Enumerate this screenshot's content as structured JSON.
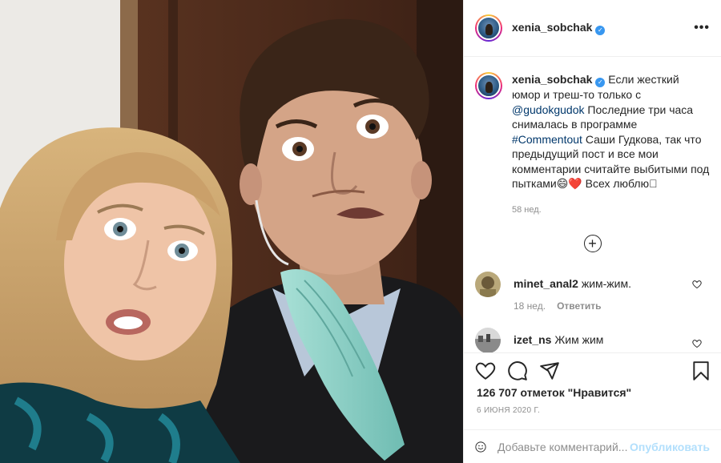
{
  "post": {
    "author": "xenia_sobchak",
    "photo_alt": "Ксения Собчак и Саша Гудков, селфи с удивлёнными лицами"
  },
  "header": {
    "username": "xenia_sobchak",
    "more_label": "•••"
  },
  "caption": {
    "author": "xenia_sobchak",
    "text_1": "Если жесткий юмор и треш-то только с ",
    "mention": "@gudokgudok",
    "text_2": " Последние три часа снималась в программе ",
    "hashtag": "#Commentout",
    "text_3": " Саши Гудкова, так что предыдущий пост и все мои комментарии считайте выбитыми под пытками😄❤️ Всех люблю🏻",
    "time": "58 нед."
  },
  "load_more": "+",
  "comments": [
    {
      "author": "minet_anal2",
      "text": "жим-жим.",
      "time": "18 нед.",
      "reply": "Ответить"
    },
    {
      "author": "izet_ns",
      "text": "Жим жим"
    }
  ],
  "likes": "126 707 отметок \"Нравится\"",
  "date": "6 ИЮНЯ 2020 Г.",
  "add_comment": {
    "placeholder": "Добавьте комментарий...",
    "publish": "Опубликовать"
  },
  "colors": {
    "link": "#00376b",
    "verified": "#3897f0",
    "publish_disabled": "#b2dffc",
    "muted": "#8e8e8e"
  },
  "icons": [
    "verified-icon",
    "more-icon",
    "plus-icon",
    "heart-icon",
    "comment-icon",
    "share-icon",
    "bookmark-icon",
    "smile-icon"
  ]
}
